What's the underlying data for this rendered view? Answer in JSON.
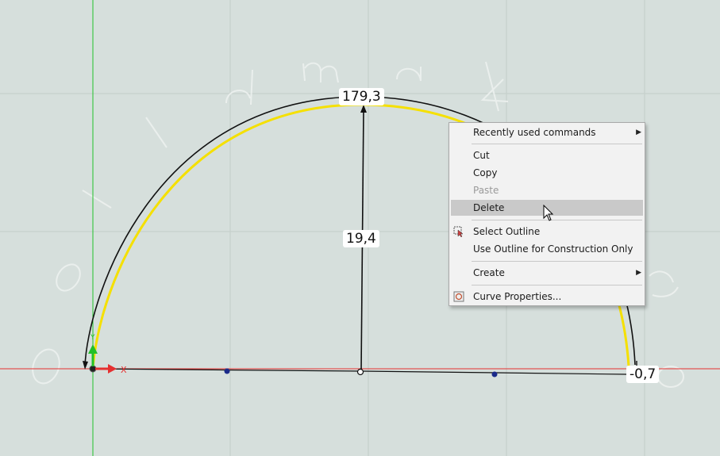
{
  "dimensions": {
    "angle_label": "179,3",
    "height_label": "19,4",
    "offset_label": "-0,7"
  },
  "axis": {
    "x_label": "X",
    "y_label": "Y"
  },
  "watermark": [
    "s",
    "o",
    "l",
    "i",
    "d",
    "m",
    "a",
    "k",
    "e",
    "r"
  ],
  "context_menu": {
    "recently_used": "Recently used commands",
    "cut": "Cut",
    "copy": "Copy",
    "paste": "Paste",
    "delete": "Delete",
    "select_outline": "Select Outline",
    "use_outline_construction": "Use Outline for Construction Only",
    "create": "Create",
    "curve_properties": "Curve Properties..."
  },
  "colors": {
    "background": "#d6dfdc",
    "grid": "#bfcac6",
    "curve_highlight": "#f5e000",
    "x_axis": "#e53030",
    "y_axis": "#22c02a",
    "menu_hover": "#c9c9c9"
  }
}
